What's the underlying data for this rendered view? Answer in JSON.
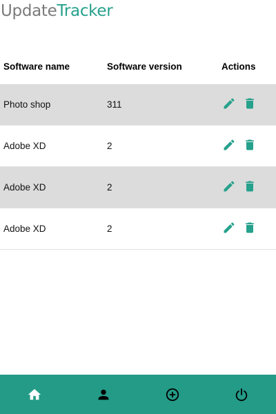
{
  "brand": {
    "part1": "Update",
    "part2": "Tracker"
  },
  "colors": {
    "accent": "#26a18c",
    "nav_background": "#239b87",
    "row_shade": "#dcdcdc",
    "title_gray": "#7a7a7a"
  },
  "table": {
    "headers": {
      "name": "Software name",
      "version": "Software version",
      "actions": "Actions"
    },
    "rows": [
      {
        "name": "Photo shop",
        "version": "311",
        "shaded": true
      },
      {
        "name": "Adobe XD",
        "version": "2",
        "shaded": false
      },
      {
        "name": "Adobe XD",
        "version": "2",
        "shaded": true
      },
      {
        "name": "Adobe XD",
        "version": "2",
        "shaded": false
      }
    ],
    "row_actions": [
      "pencil-icon",
      "trash-icon"
    ]
  },
  "bottom_nav": {
    "items": [
      "home-icon",
      "person-icon",
      "add-circle-icon",
      "power-icon"
    ]
  }
}
